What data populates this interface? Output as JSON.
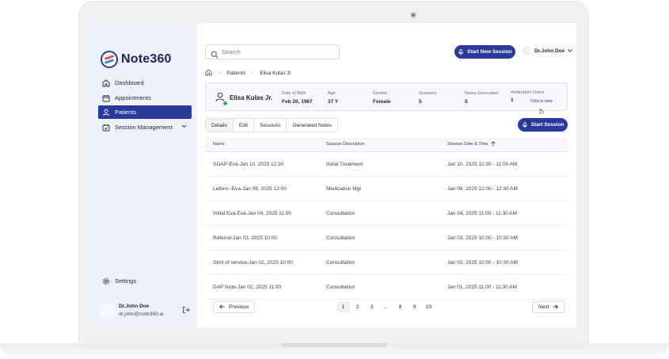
{
  "sidebar": {
    "logo_text": "Note360",
    "items": [
      {
        "label": "Dashboard",
        "icon": "home-icon"
      },
      {
        "label": "Appointments",
        "icon": "calendar-icon"
      },
      {
        "label": "Patients",
        "icon": "user-icon",
        "active": true
      },
      {
        "label": "Session Management",
        "icon": "calendar-check-icon",
        "expandable": true
      }
    ],
    "settings_label": "Settings",
    "user": {
      "name": "Dr.John Doe",
      "email": "dr.john@note360.ai"
    }
  },
  "header": {
    "search_placeholder": "Search",
    "start_new_session_label": "Start New Session",
    "user_name": "Dr.John Doe"
  },
  "breadcrumb": {
    "items": [
      "Patients",
      "Elisa Kulas Jr"
    ]
  },
  "patient": {
    "name": "Elisa Kulas Jr.",
    "fields": [
      {
        "label": "Date of Birth",
        "value": "Feb 20, 1987"
      },
      {
        "label": "Age",
        "value": "37 Y"
      },
      {
        "label": "Gender",
        "value": "Female"
      },
      {
        "label": "Sessions",
        "value": "5"
      },
      {
        "label": "Notes Generated",
        "value": "5"
      },
      {
        "label": "Addendum Notes",
        "value": "1",
        "link": "Click to view"
      }
    ]
  },
  "tabs": [
    "Details",
    "Edit",
    "Sessions",
    "Generated Notes"
  ],
  "start_session_label": "Start Session",
  "table": {
    "columns": [
      "Name",
      "Session Description",
      "Session Date & Time"
    ],
    "rows": [
      {
        "name": "SOAP-Eva-Jan 10, 2025 12:30",
        "description": "Initial Treatment",
        "datetime": "Jan 10, 2025 12:30 - 11:00 AM"
      },
      {
        "name": "Letters -Eva-Jan 09, 2025 12:00",
        "description": "Medication Mgt",
        "datetime": "Jan 09, 2025 12:00 - 12:30 AM"
      },
      {
        "name": "Initial Eva-Eva-Jan 04, 2025 11:00",
        "description": "Consultation",
        "datetime": "Jan 04, 2025 11:00 - 11:30 AM"
      },
      {
        "name": "Referral-Jan 03, 2025 10:00",
        "description": "Consultation",
        "datetime": "Jan 03, 2025 10:00 - 10:30 AM"
      },
      {
        "name": "Stmt of service-Jan 02, 2025 10:00",
        "description": "Consultation",
        "datetime": "Jan 02, 2025 10:00 - 10:30 AM"
      },
      {
        "name": "DAP Note-Jan 01, 2025 11:00",
        "description": "Consultation",
        "datetime": "Jan 01, 2025 11:00 - 11:30 AM"
      }
    ]
  },
  "pagination": {
    "previous_label": "Previous",
    "next_label": "Next",
    "pages": [
      "1",
      "2",
      "3",
      "...",
      "8",
      "9",
      "10"
    ],
    "current": "1"
  },
  "colors": {
    "primary": "#2b3a9a",
    "sidebar_bg": "#eef0fa",
    "online": "#2fb55a"
  }
}
